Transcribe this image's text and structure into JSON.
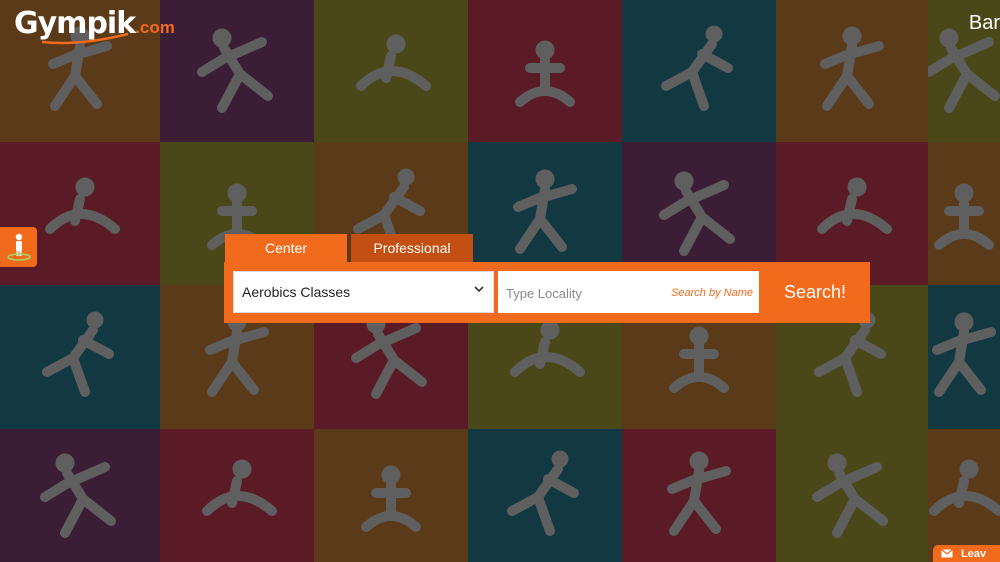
{
  "brand": {
    "logo_text": "Gympik",
    "logo_suffix": ".com"
  },
  "header": {
    "top_right_text": "Bar"
  },
  "search": {
    "tabs": [
      {
        "label": "Center",
        "active": true
      },
      {
        "label": "Professional",
        "active": false
      }
    ],
    "category_value": "Aerobics Classes",
    "locality_placeholder": "Type Locality",
    "search_by_name_label": "Search by Name",
    "search_button_label": "Search!"
  },
  "leave_message": {
    "label": "Leav"
  },
  "colors": {
    "accent": "#f26a1b",
    "accent_dark": "#c35012",
    "figure_gray": "#5f5f5f"
  },
  "background_tiles": [
    {
      "color": "#5a3a18",
      "icon": "yoga-bend-icon"
    },
    {
      "color": "#3b1d35",
      "icon": "badminton-player-icon"
    },
    {
      "color": "#4a4818",
      "icon": "kicking-player-icon"
    },
    {
      "color": "#5a1a26",
      "icon": "dancer-icon"
    },
    {
      "color": "#123942",
      "icon": "cyclist-icon"
    },
    {
      "color": "#5a3a18",
      "icon": "jumping-dancer-icon"
    },
    {
      "color": "#4a4818",
      "icon": "figure-icon"
    },
    {
      "color": "#5a1a26",
      "icon": "runner-icon"
    },
    {
      "color": "#4a4818",
      "icon": "yoga-stretch-icon"
    },
    {
      "color": "#5a3a18",
      "icon": "crawling-stretch-icon"
    },
    {
      "color": "#123942",
      "icon": "treadmill-runner-icon"
    },
    {
      "color": "#3b1d35",
      "icon": "leaping-figure-icon"
    },
    {
      "color": "#5a1a26",
      "icon": "backbend-figure-icon"
    },
    {
      "color": "#5a3a18",
      "icon": "figure-icon"
    },
    {
      "color": "#123942",
      "icon": "dancer-arc-icon"
    },
    {
      "color": "#5a3a18",
      "icon": "meditation-icon"
    },
    {
      "color": "#5a1a26",
      "icon": "gymnast-arc-icon"
    },
    {
      "color": "#4a4818",
      "icon": "yoga-seated-icon"
    },
    {
      "color": "#5a3a18",
      "icon": "reclining-figure-icon"
    },
    {
      "color": "#4a4818",
      "icon": "cobra-pose-icon"
    },
    {
      "color": "#123942",
      "icon": "weightlifter-icon"
    },
    {
      "color": "#3b1d35",
      "icon": "tree-pose-icon"
    },
    {
      "color": "#5a1a26",
      "icon": "stretching-arc-icon"
    },
    {
      "color": "#5a3a18",
      "icon": "sprinter-icon"
    },
    {
      "color": "#123942",
      "icon": "inverted-yoga-icon"
    },
    {
      "color": "#5a1a26",
      "icon": "dumbbell-lifter-icon"
    },
    {
      "color": "#4a4818",
      "icon": "bridge-pose-icon"
    },
    {
      "color": "#5a3a18",
      "icon": "figure-icon"
    }
  ]
}
